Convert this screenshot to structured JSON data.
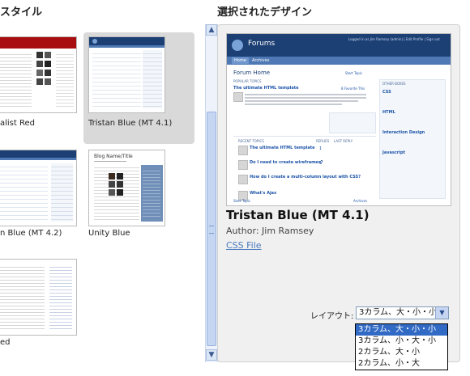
{
  "headers": {
    "styles": "スタイル",
    "selected_design": "選択されたデザイン"
  },
  "styles": [
    {
      "label": "alist Red"
    },
    {
      "label": "Tristan Blue (MT 4.1)"
    },
    {
      "label": "n Blue (MT 4.2)"
    },
    {
      "label": "Unity Blue"
    },
    {
      "label": "ed"
    }
  ],
  "selected": {
    "title": "Tristan Blue (MT 4.1)",
    "author": "Author: Jim Ramsey",
    "css_link": "CSS File"
  },
  "preview": {
    "brand": "Forums",
    "userbar": "Logged in as Jim Ramsey (admin) | Edit Profile | Sign out",
    "tabs": [
      "Home",
      "Archives"
    ],
    "page_title": "Forum Home",
    "start_topic": "Start Topic",
    "popular_topics": "POPULAR TOPICS",
    "featured_title": "The ultimate HTML template",
    "favorites": "8 Favorite This",
    "other_boxes": "OTHER BOXES",
    "recent_topics": "RECENT TOPICS",
    "replies": "REPLIES",
    "last_reply": "LAST REPLY",
    "topics": [
      "The ultimate HTML template",
      "Do I need to create wireframes?",
      "How do I create a multi-column layout with CSS?",
      "What's Ajax"
    ],
    "reply_counts": [
      "1",
      "1",
      "",
      ""
    ],
    "side_cats": [
      "CSS",
      "HTML",
      "Interaction Design",
      "Javascript"
    ],
    "archives": "Archives"
  },
  "layout": {
    "label": "レイアウト:",
    "current": "3カラム、大・小・小",
    "options": [
      "3カラム、大・小・小",
      "3カラム、小・大・小",
      "2カラム、大・小",
      "2カラム、小・大"
    ]
  },
  "colors": {
    "accent": "#316ac5",
    "preview_header": "#1c3f74",
    "link": "#4a7abf"
  }
}
